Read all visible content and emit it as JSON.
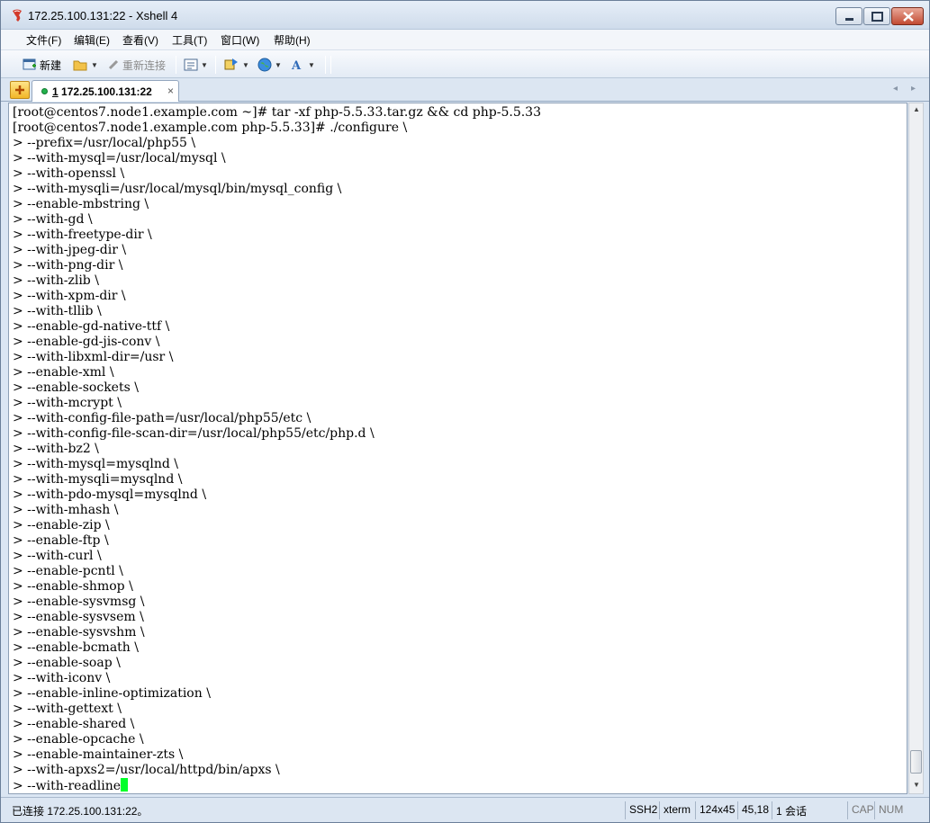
{
  "window": {
    "title": "172.25.100.131:22 - Xshell 4"
  },
  "menu": [
    "文件(F)",
    "编辑(E)",
    "查看(V)",
    "工具(T)",
    "窗口(W)",
    "帮助(H)"
  ],
  "toolbar": {
    "new_label": "新建",
    "reconnect_label": "重新连接"
  },
  "tab": {
    "number": "1",
    "label": "172.25.100.131:22",
    "close": "×"
  },
  "terminal": {
    "lines": [
      "[root@centos7.node1.example.com ~]# tar -xf php-5.5.33.tar.gz && cd php-5.5.33",
      "[root@centos7.node1.example.com php-5.5.33]# ./configure \\",
      "> --prefix=/usr/local/php55 \\",
      "> --with-mysql=/usr/local/mysql \\",
      "> --with-openssl \\",
      "> --with-mysqli=/usr/local/mysql/bin/mysql_config \\",
      "> --enable-mbstring \\",
      "> --with-gd \\",
      "> --with-freetype-dir \\",
      "> --with-jpeg-dir \\",
      "> --with-png-dir \\",
      "> --with-zlib \\",
      "> --with-xpm-dir \\",
      "> --with-tllib \\",
      "> --enable-gd-native-ttf \\",
      "> --enable-gd-jis-conv \\",
      "> --with-libxml-dir=/usr \\",
      "> --enable-xml \\",
      "> --enable-sockets \\",
      "> --with-mcrypt \\",
      "> --with-config-file-path=/usr/local/php55/etc \\",
      "> --with-config-file-scan-dir=/usr/local/php55/etc/php.d \\",
      "> --with-bz2 \\",
      "> --with-mysql=mysqlnd \\",
      "> --with-mysqli=mysqlnd \\",
      "> --with-pdo-mysql=mysqlnd \\",
      "> --with-mhash \\",
      "> --enable-zip \\",
      "> --enable-ftp \\",
      "> --with-curl \\",
      "> --enable-pcntl \\",
      "> --enable-shmop \\",
      "> --enable-sysvmsg \\",
      "> --enable-sysvsem \\",
      "> --enable-sysvshm \\",
      "> --enable-bcmath \\",
      "> --enable-soap \\",
      "> --with-iconv \\",
      "> --enable-inline-optimization \\",
      "> --with-gettext \\",
      "> --enable-shared \\",
      "> --enable-opcache \\",
      "> --enable-maintainer-zts \\",
      "> --with-apxs2=/usr/local/httpd/bin/apxs \\",
      "> --with-readline"
    ],
    "cursor_color": "#00ff2a"
  },
  "status": {
    "connection": "已连接 172.25.100.131:22。",
    "protocol": "SSH2",
    "term": "xterm",
    "size": "124x45",
    "position": "45,18",
    "sessions": "1 会话",
    "cap": "CAP",
    "num": "NUM"
  }
}
